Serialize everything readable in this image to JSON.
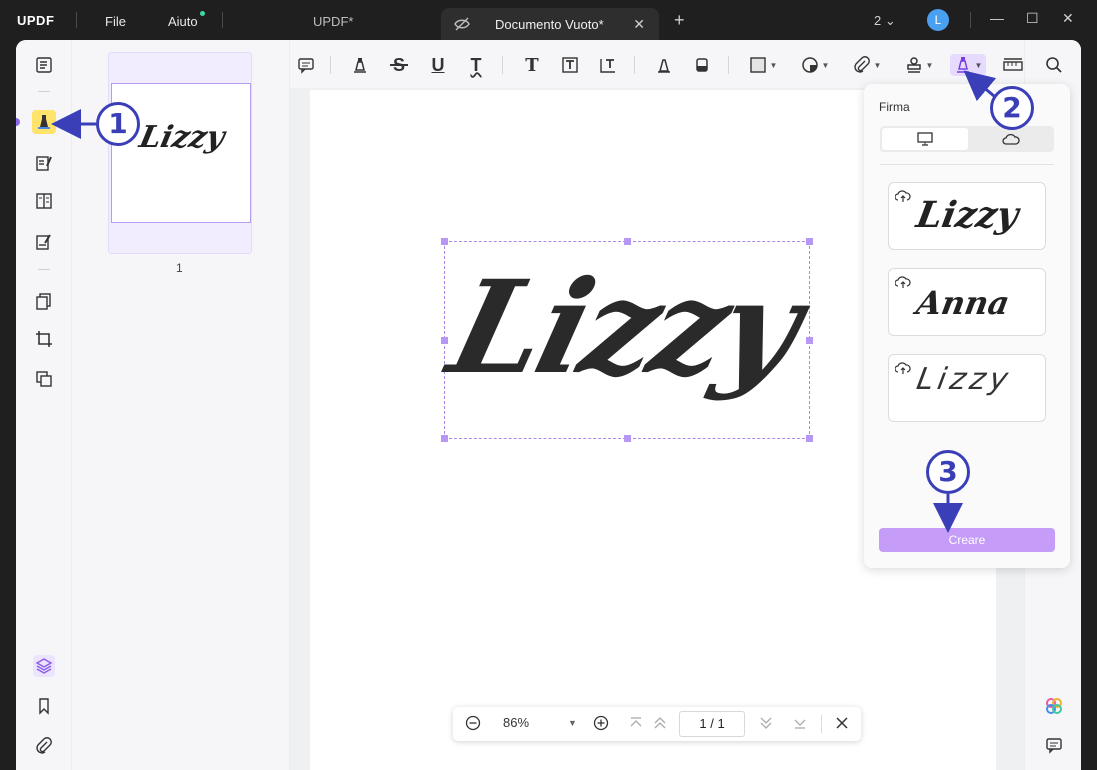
{
  "titlebar": {
    "logo": "UPDF",
    "menu_file": "File",
    "menu_help": "Aiuto",
    "inactive_tab": "UPDF*",
    "active_tab": "Documento Vuoto*",
    "window_count": "2",
    "avatar_letter": "L"
  },
  "thumbnails": {
    "page_number": "1",
    "signature_text": "Lizzy"
  },
  "document": {
    "signature_text": "Lizzy"
  },
  "signature_panel": {
    "title": "Firma",
    "signatures": [
      "Lizzy",
      "Anna",
      "Lizzy"
    ],
    "create_label": "Creare"
  },
  "navigator": {
    "zoom": "86%",
    "current_page": "1",
    "total_pages": "1",
    "separator": "/"
  },
  "callouts": [
    "1",
    "2",
    "3"
  ],
  "colors": {
    "accent": "#c59cf8",
    "active_tool": "#e6dbff",
    "highlight": "#ffe36a",
    "callout": "#3a3fb8"
  }
}
